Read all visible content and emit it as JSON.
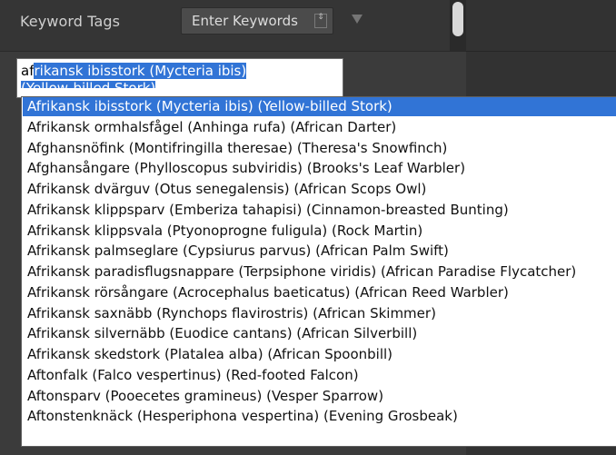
{
  "keyword_panel": {
    "label": "Keyword Tags",
    "mode": "Enter Keywords",
    "stepper_glyph": "⇕",
    "triangle_icon": "triangle-down-icon"
  },
  "entry": {
    "typed": "af",
    "completion": "rikansk ibisstork (Mycteria ibis)",
    "second_line": "(Yellow-billed Stork)"
  },
  "suggestions": [
    "Afrikansk ibisstork (Mycteria ibis) (Yellow-billed Stork)",
    "Afrikansk ormhalsfågel (Anhinga rufa) (African Darter)",
    "Afghansnöfink (Montifringilla theresae) (Theresa's Snowfinch)",
    "Afghansångare (Phylloscopus subviridis) (Brooks's Leaf Warbler)",
    "Afrikansk dvärguv (Otus senegalensis) (African Scops Owl)",
    "Afrikansk klippsparv (Emberiza tahapisi) (Cinnamon-breasted Bunting)",
    "Afrikansk klippsvala (Ptyonoprogne fuligula) (Rock Martin)",
    "Afrikansk palmseglare (Cypsiurus parvus) (African Palm Swift)",
    "Afrikansk paradisflugsnappare (Terpsiphone viridis) (African Paradise Flycatcher)",
    "Afrikansk rörsångare (Acrocephalus baeticatus) (African Reed Warbler)",
    "Afrikansk saxnäbb (Rynchops flavirostris) (African Skimmer)",
    "Afrikansk silvernäbb (Euodice cantans) (African Silverbill)",
    "Afrikansk skedstork (Platalea alba) (African Spoonbill)",
    "Aftonfalk (Falco vespertinus) (Red-footed Falcon)",
    "Aftonsparv (Pooecetes gramineus) (Vesper Sparrow)",
    "Aftonstenknäck (Hesperiphona vespertina) (Evening Grosbeak)"
  ],
  "active_index": 0,
  "colors": {
    "highlight": "#3174d6",
    "panel": "#3b3b3b"
  }
}
